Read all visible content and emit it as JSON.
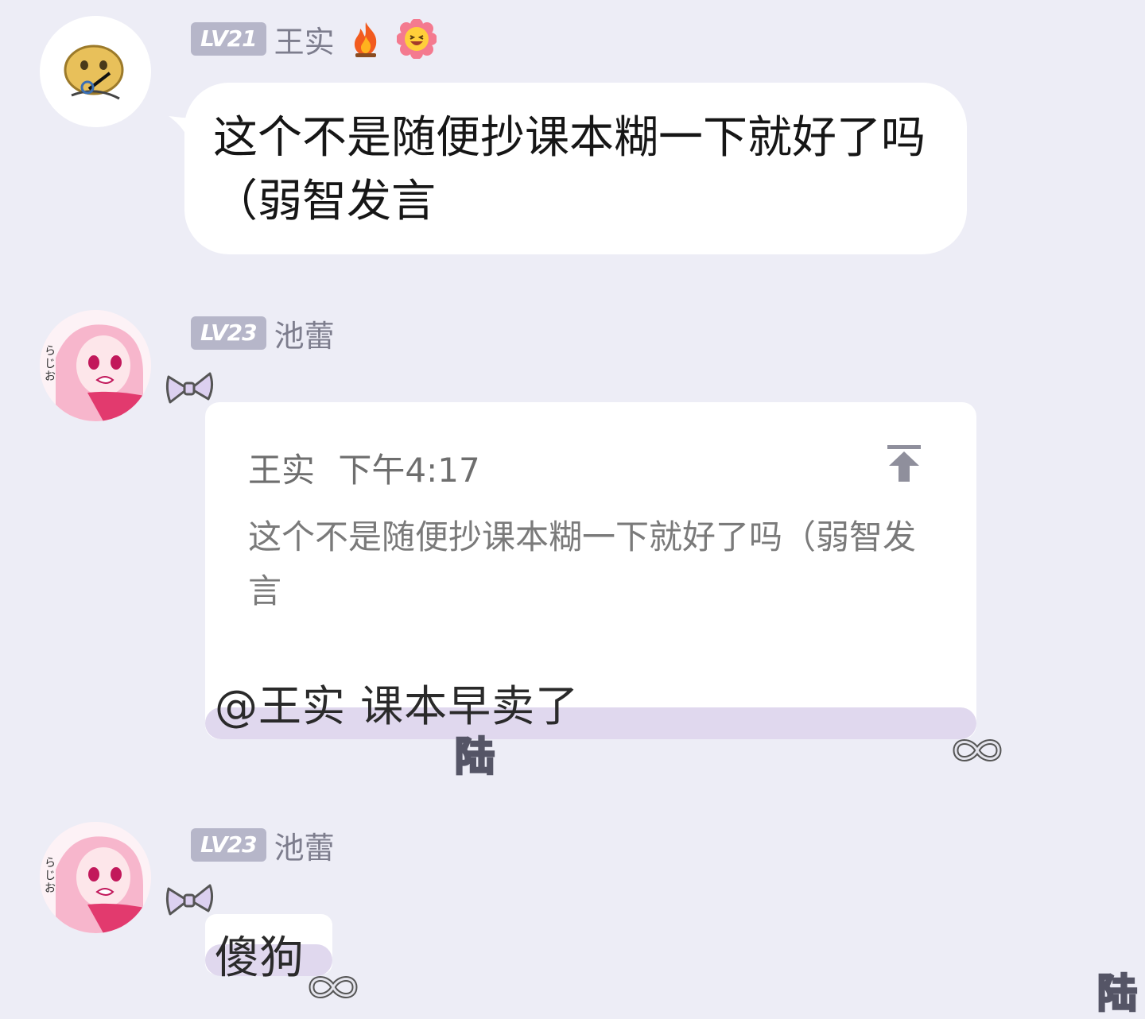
{
  "messages": [
    {
      "level": "LV21",
      "name": "王实",
      "text": "这个不是随便抄课本糊一下就好了吗（弱智发言"
    },
    {
      "level": "LV23",
      "name": "池蕾",
      "quote": {
        "author": "王实",
        "time": "下午4:17",
        "text": "这个不是随便抄课本糊一下就好了吗（弱智发言"
      },
      "text": "@王实 课本早卖了",
      "sticker": "陆"
    },
    {
      "level": "LV23",
      "name": "池蕾",
      "text": "傻狗",
      "sticker": "陆"
    }
  ],
  "icons": {
    "fire": "fire-icon",
    "laugh": "laughing-flower-icon",
    "quote_jump": "jump-to-top-icon",
    "bow": "bow-decoration",
    "infinity": "infinity-decoration"
  },
  "colors": {
    "background": "#ededf6",
    "bubble": "#ffffff",
    "level_badge": "#b6b6c9",
    "bubble_bar": "#e0d8ee"
  }
}
